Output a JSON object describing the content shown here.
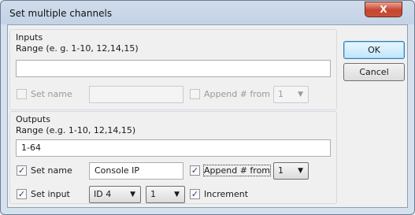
{
  "window": {
    "title": "Set multiple channels",
    "close_label": "X"
  },
  "inputs": {
    "group_label": "Inputs",
    "range_label": "Range (e. g. 1-10, 12,14,15)",
    "range_value": "",
    "set_name_label": "Set name",
    "set_name_checked": false,
    "name_value": "",
    "append_label": "Append # from",
    "append_checked": false,
    "append_from_value": "1"
  },
  "outputs": {
    "group_label": "Outputs",
    "range_label": "Range (e.g. 1-10, 12,14,15)",
    "range_value": "1-64",
    "set_name_label": "Set name",
    "set_name_checked": true,
    "name_value": "Console IP",
    "append_label": "Append # from",
    "append_checked": true,
    "append_from_value": "1",
    "set_input_label": "Set input",
    "set_input_checked": true,
    "input_id_value": "ID 4",
    "input_channel_value": "1",
    "increment_label": "Increment",
    "increment_checked": true
  },
  "buttons": {
    "ok": "OK",
    "cancel": "Cancel"
  },
  "icons": {
    "check": "✓",
    "dropdown": "▼",
    "close": "close-icon"
  }
}
